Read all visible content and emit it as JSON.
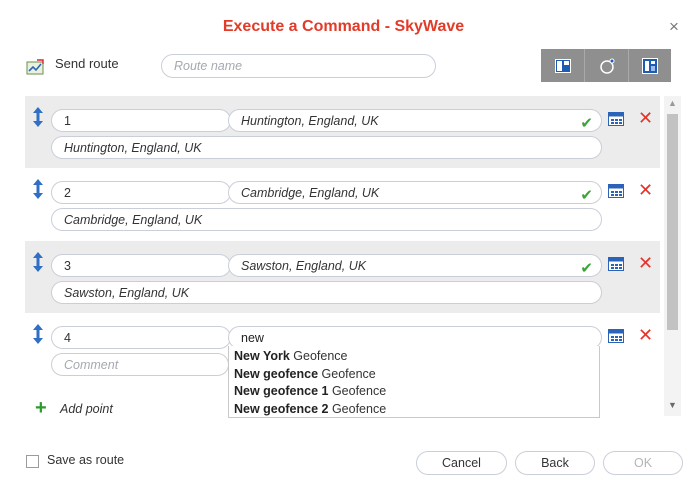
{
  "dialog": {
    "title": "Execute a Command - SkyWave",
    "close_glyph": "×"
  },
  "header": {
    "send_route_label": "Send route",
    "route_name_placeholder": "Route name",
    "toolbar_icons": [
      "layout-icon",
      "geofence-circle-icon",
      "calculator-panel-icon"
    ]
  },
  "points": [
    {
      "index": "1",
      "location": "Huntington, England, UK",
      "description": "Huntington, England, UK",
      "validated": true
    },
    {
      "index": "2",
      "location": "Cambridge, England, UK",
      "description": "Cambridge, England, UK",
      "validated": true
    },
    {
      "index": "3",
      "location": "Sawston, England, UK",
      "description": "Sawston, England, UK",
      "validated": true
    }
  ],
  "editing_point": {
    "index": "4",
    "location_value": "new",
    "comment_placeholder": "Comment"
  },
  "suggestions": [
    {
      "match": "New York",
      "rest": " Geofence"
    },
    {
      "match": "New geofence",
      "rest": " Geofence"
    },
    {
      "match": "New geofence 1",
      "rest": " Geofence"
    },
    {
      "match": "New geofence 2",
      "rest": " Geofence"
    }
  ],
  "add_point_label": "Add point",
  "footer": {
    "save_as_route_label": "Save as route",
    "save_as_route_checked": false,
    "cancel_label": "Cancel",
    "back_label": "Back",
    "ok_label": "OK",
    "ok_enabled": false
  },
  "colors": {
    "title": "#e23b2a",
    "check": "#3aa535",
    "delete": "#e6332a",
    "add": "#2e9a2e",
    "drag_icon": "#2f6fc4",
    "toolbar_bg": "#8f8f8f"
  }
}
